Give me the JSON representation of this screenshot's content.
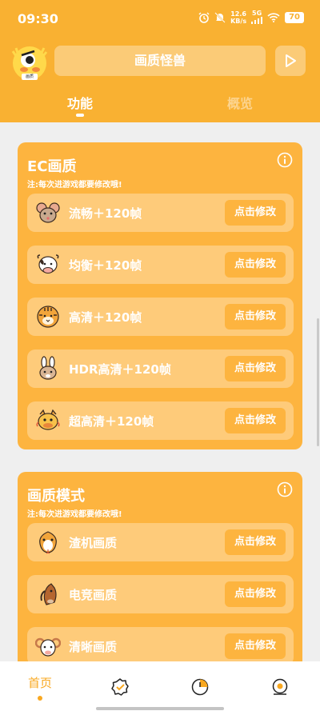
{
  "status_bar": {
    "time": "09:30",
    "net_speed_value": "12.6",
    "net_speed_unit": "KB/s",
    "signal": "5G",
    "battery": "70"
  },
  "header": {
    "title": "画质怪兽",
    "avatar_badge": "画质"
  },
  "tabs": [
    {
      "label": "功能",
      "active": true
    },
    {
      "label": "概览",
      "active": false
    }
  ],
  "cards": [
    {
      "title": "EC画质",
      "note": "注:每次进游戏都要修改哦!",
      "items": [
        {
          "label": "流畅＋120帧",
          "icon": "mouse-icon",
          "button": "点击修改"
        },
        {
          "label": "均衡＋120帧",
          "icon": "ox-icon",
          "button": "点击修改"
        },
        {
          "label": "高清＋120帧",
          "icon": "tiger-icon",
          "button": "点击修改"
        },
        {
          "label": "HDR高清＋120帧",
          "icon": "rabbit-icon",
          "button": "点击修改"
        },
        {
          "label": "超高清＋120帧",
          "icon": "dragon-icon",
          "button": "点击修改"
        }
      ]
    },
    {
      "title": "画质模式",
      "note": "注:每次进游戏都要修改哦!",
      "items": [
        {
          "label": "渣机画质",
          "icon": "snake-icon",
          "button": "点击修改"
        },
        {
          "label": "电竞画质",
          "icon": "horse-icon",
          "button": "点击修改"
        },
        {
          "label": "清晰画质",
          "icon": "ram-icon",
          "button": "点击修改"
        }
      ]
    }
  ],
  "bottom_nav": [
    {
      "label": "首页",
      "icon": "home",
      "active": true
    },
    {
      "label": "",
      "icon": "verified-badge-icon",
      "active": false
    },
    {
      "label": "",
      "icon": "pie-chart-icon",
      "active": false
    },
    {
      "label": "",
      "icon": "profile-icon",
      "active": false
    }
  ],
  "colors": {
    "primary": "#f9b132",
    "card": "#fdb43f",
    "row": "#fecb7a",
    "accent": "#f9a820"
  }
}
